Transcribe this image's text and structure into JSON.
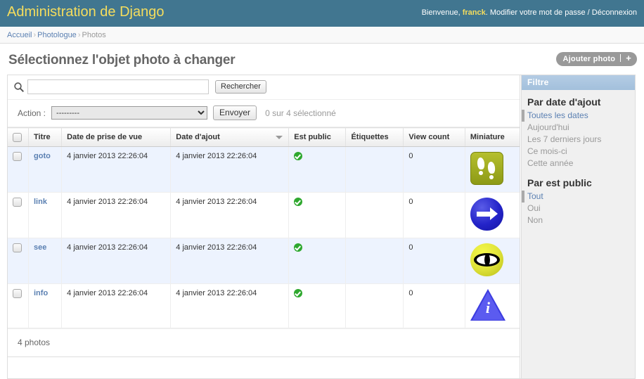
{
  "header": {
    "site_title": "Administration de Django",
    "welcome_prefix": "Bienvenue,",
    "username": "franck",
    "welcome_suffix": ".",
    "change_password_label": "Modifier votre mot de passe",
    "separator": "/",
    "logout_label": "Déconnexion",
    "bg_color": "#417690",
    "title_color": "#f5dd5d"
  },
  "breadcrumbs": {
    "home": "Accueil",
    "app": "Photologue",
    "current": "Photos",
    "sep": "›"
  },
  "content": {
    "title": "Sélectionnez l'objet photo à changer",
    "add_button_label": "Ajouter photo",
    "add_button_plus": "+"
  },
  "search": {
    "value": "",
    "placeholder": "",
    "button_label": "Rechercher",
    "icon": "search-icon"
  },
  "actions": {
    "label": "Action :",
    "selected_option": "---------",
    "options": [
      "---------"
    ],
    "submit_label": "Envoyer",
    "counter": "0 sur 4 sélectionné"
  },
  "table": {
    "columns": [
      {
        "key": "checkbox",
        "label": ""
      },
      {
        "key": "title",
        "label": "Titre"
      },
      {
        "key": "date_taken",
        "label": "Date de prise de vue"
      },
      {
        "key": "date_added",
        "label": "Date d'ajout",
        "sorted": "desc"
      },
      {
        "key": "is_public",
        "label": "Est public"
      },
      {
        "key": "tags",
        "label": "Étiquettes"
      },
      {
        "key": "view_count",
        "label": "View count"
      },
      {
        "key": "thumbnail",
        "label": "Miniature"
      }
    ],
    "rows": [
      {
        "title": "goto",
        "date_taken": "4 janvier 2013 22:26:04",
        "date_added": "4 janvier 2013 22:26:04",
        "is_public": "yes-icon",
        "tags": "",
        "view_count": "0",
        "thumbnail": "footprints-thumbnail"
      },
      {
        "title": "link",
        "date_taken": "4 janvier 2013 22:26:04",
        "date_added": "4 janvier 2013 22:26:04",
        "is_public": "yes-icon",
        "tags": "",
        "view_count": "0",
        "thumbnail": "blue-arrow-thumbnail"
      },
      {
        "title": "see",
        "date_taken": "4 janvier 2013 22:26:04",
        "date_added": "4 janvier 2013 22:26:04",
        "is_public": "yes-icon",
        "tags": "",
        "view_count": "0",
        "thumbnail": "yellow-eye-thumbnail"
      },
      {
        "title": "info",
        "date_taken": "4 janvier 2013 22:26:04",
        "date_added": "4 janvier 2013 22:26:04",
        "is_public": "yes-icon",
        "tags": "",
        "view_count": "0",
        "thumbnail": "info-triangle-thumbnail"
      }
    ],
    "paginator": "4 photos"
  },
  "filter": {
    "title": "Filtre",
    "groups": [
      {
        "heading": "Par date d'ajout",
        "options": [
          {
            "label": "Toutes les dates",
            "selected": true
          },
          {
            "label": "Aujourd'hui",
            "selected": false
          },
          {
            "label": "Les 7 derniers jours",
            "selected": false
          },
          {
            "label": "Ce mois-ci",
            "selected": false
          },
          {
            "label": "Cette année",
            "selected": false
          }
        ]
      },
      {
        "heading": "Par est public",
        "options": [
          {
            "label": "Tout",
            "selected": true
          },
          {
            "label": "Oui",
            "selected": false
          },
          {
            "label": "Non",
            "selected": false
          }
        ]
      }
    ]
  }
}
